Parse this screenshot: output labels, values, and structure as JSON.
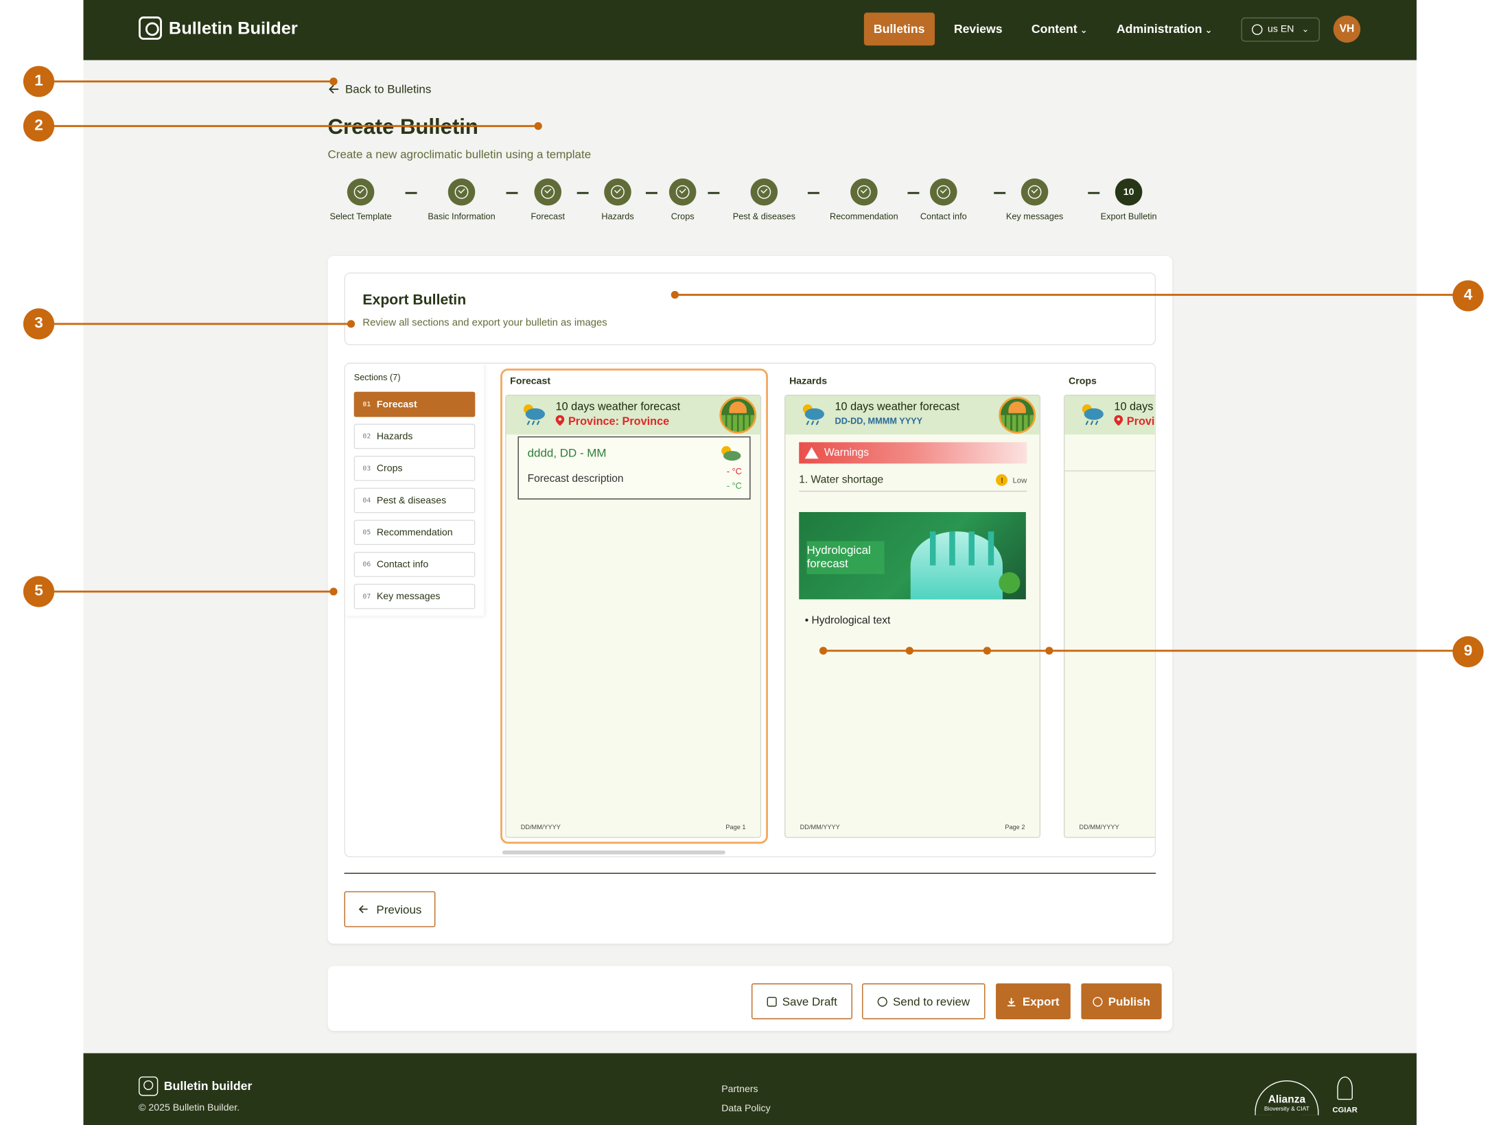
{
  "header": {
    "brand": "Bulletin Builder",
    "nav": [
      {
        "label": "Bulletins",
        "active": true
      },
      {
        "label": "Reviews"
      },
      {
        "label": "Content"
      },
      {
        "label": "Administration"
      }
    ],
    "language": "us EN",
    "avatar_initials": "VH"
  },
  "page": {
    "back_label": "Back to Bulletins",
    "title": "Create Bulletin",
    "subtitle": "Create a new agroclimatic bulletin using a template"
  },
  "stepper": {
    "steps": [
      "Select Template",
      "Basic Information",
      "Forecast",
      "Hazards",
      "Crops",
      "Pest & diseases",
      "Recommendation",
      "Contact info",
      "Key messages",
      "Export Bulletin"
    ],
    "current_number": "10"
  },
  "export": {
    "title": "Export Bulletin",
    "subtitle": "Review all sections and export your bulletin as images"
  },
  "sections": {
    "title": "Sections (7)",
    "items": [
      {
        "num": "01",
        "label": "Forecast",
        "active": true
      },
      {
        "num": "02",
        "label": "Hazards"
      },
      {
        "num": "03",
        "label": "Crops"
      },
      {
        "num": "04",
        "label": "Pest & diseases"
      },
      {
        "num": "05",
        "label": "Recommendation"
      },
      {
        "num": "06",
        "label": "Contact info"
      },
      {
        "num": "07",
        "label": "Key messages"
      }
    ]
  },
  "previews": {
    "forecast": {
      "col_title": "Forecast",
      "head_title": "10 days weather forecast",
      "province": "Province: Province",
      "card_date": "dddd, DD - MM",
      "card_desc": "Forecast description",
      "temp_max": "- °C",
      "temp_min": "- °C",
      "foot_date": "DD/MM/YYYY",
      "foot_page": "Page 1"
    },
    "hazards": {
      "col_title": "Hazards",
      "head_title": "10 days weather forecast",
      "head_date": "DD-DD, MMMM YYYY",
      "warnings": "Warnings",
      "hazard_item": "1.  Water shortage",
      "hazard_level": "Low",
      "hazard_level_badge": "!",
      "image_label": "Hydrological forecast",
      "hydro_text": "•  Hydrological text",
      "foot_date": "DD/MM/YYYY",
      "foot_page": "Page 2"
    },
    "crops": {
      "col_title": "Crops",
      "head_title": "10 days",
      "province": "Provi",
      "foot_date": "DD/MM/YYYY"
    }
  },
  "nav_buttons": {
    "previous": "Previous"
  },
  "actions": {
    "save_draft": "Save Draft",
    "send_review": "Send to review",
    "export": "Export",
    "publish": "Publish"
  },
  "footer": {
    "brand": "Bulletin builder",
    "copyright": "© 2025 Bulletin Builder.",
    "links": [
      "Partners",
      "Data Policy"
    ],
    "partner_name": "Alianza",
    "partner_sub": "Bioversity & CIAT",
    "cgiar": "CGIAR"
  },
  "annotations": [
    "1",
    "2",
    "3",
    "4",
    "5",
    "9"
  ],
  "colors": {
    "primary_dark": "#283618",
    "accent": "#bc6c25",
    "olive": "#606c38",
    "annotation": "#c8680f"
  }
}
